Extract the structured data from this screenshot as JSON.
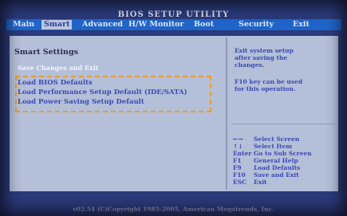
{
  "app": {
    "title": "BIOS SETUP UTILITY"
  },
  "menu": [
    {
      "label": "Main"
    },
    {
      "label": "Smart"
    },
    {
      "label": "Advanced"
    },
    {
      "label": "H/W Monitor"
    },
    {
      "label": "Boot"
    },
    {
      "label": "Security"
    },
    {
      "label": "Exit"
    }
  ],
  "menu_active": "Smart",
  "left": {
    "section_title": "Smart Settings",
    "save_exit": "Save Changes and Exit",
    "options": [
      {
        "label": "Load BIOS Defaults"
      },
      {
        "label": "Load Performance Setup Default (IDE/SATA)"
      },
      {
        "label": "Load Power Saving Setup Default"
      }
    ]
  },
  "help": {
    "line1": "Exit system setup",
    "line2": "after saving the",
    "line3": "changes.",
    "line4": "F10 key can be used",
    "line5": "for this operation."
  },
  "keys": [
    {
      "key": "←→",
      "desc": "Select Screen"
    },
    {
      "key": "↑↓",
      "desc": "Select Item"
    },
    {
      "key": "Enter",
      "desc": "Go to Sub Screen"
    },
    {
      "key": "F1",
      "desc": "General Help"
    },
    {
      "key": "F9",
      "desc": "Load Defaults"
    },
    {
      "key": "F10",
      "desc": "Save and Exit"
    },
    {
      "key": "ESC",
      "desc": "Exit"
    }
  ],
  "footer": "v02.54 (C)Copyright 1985-2005, American Megatrends, Inc.",
  "colors": {
    "menubar": "#1f64c8",
    "panel": "#b4bfd8",
    "highlight_box": "#f39a20",
    "option_text": "#3b4ab5"
  }
}
